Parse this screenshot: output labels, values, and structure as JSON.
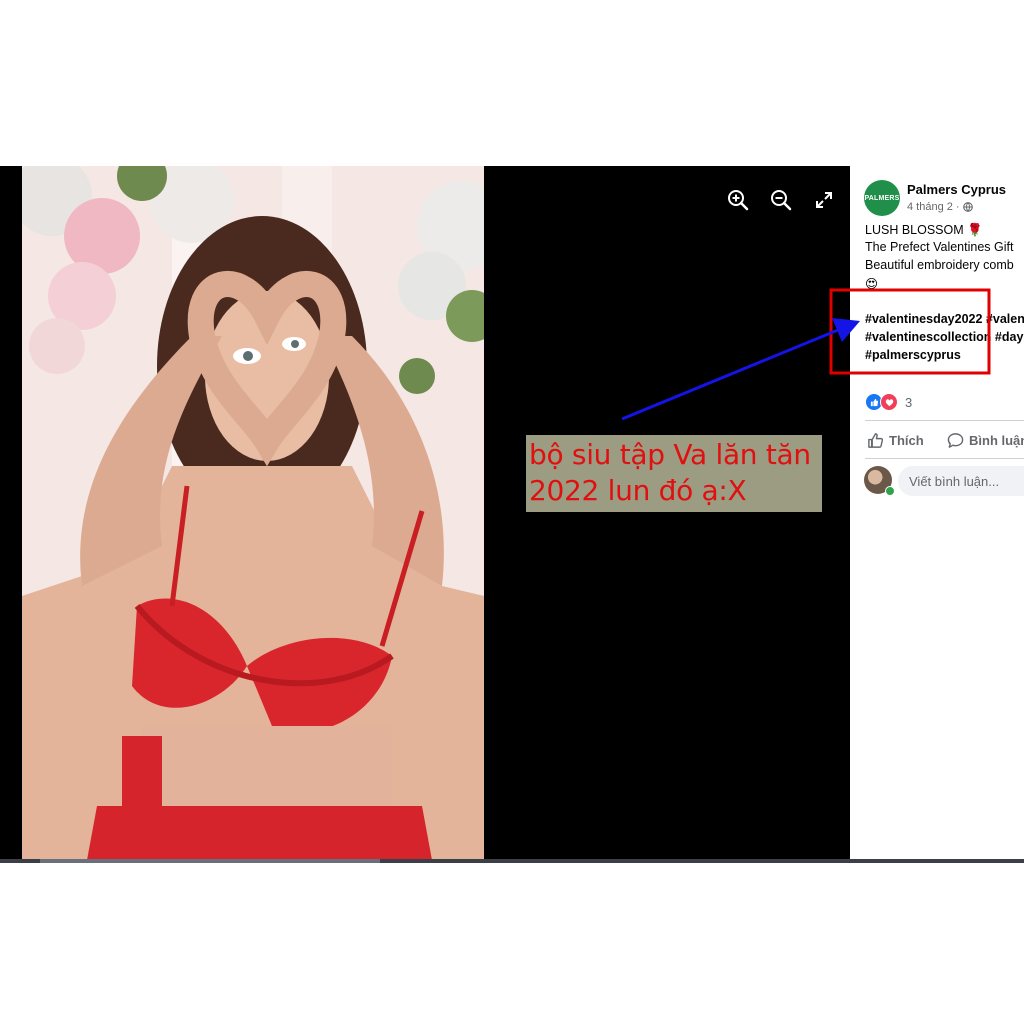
{
  "viewer": {
    "zoom_in_icon": "zoom-in-icon",
    "zoom_out_icon": "zoom-out-icon",
    "fullscreen_icon": "fullscreen-icon"
  },
  "annotation": {
    "line1": "bộ siu tập Va lăn tăn",
    "line2": "2022 lun đó ạ:X",
    "text_color": "#e01010",
    "box_color": "#9c9c82",
    "arrow_color": "#1414e6",
    "highlight_color": "#e00000"
  },
  "post": {
    "page_name": "Palmers Cyprus",
    "logo_text": "PALMERS",
    "date": "4 tháng 2 ·",
    "privacy_icon": "globe-icon",
    "lines": [
      "LUSH BLOSSOM 🌹",
      "The Prefect Valentines Gift",
      "Beautiful embroidery comb",
      "😍"
    ],
    "hashtags": [
      "#valentinesday2022 #valen",
      "#valentinescollection #day",
      "#palmerscyprus"
    ],
    "reaction_count": "3",
    "like_label": "Thích",
    "comment_label": "Bình luận",
    "comment_placeholder": "Viết bình luận..."
  },
  "colors": {
    "accent": "#1877f2",
    "love": "#f33e58",
    "brand_green": "#1f8f4a"
  }
}
